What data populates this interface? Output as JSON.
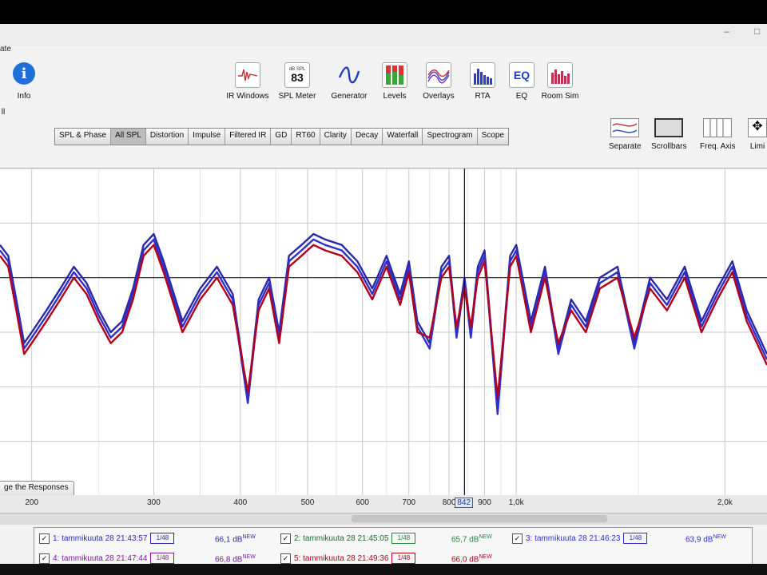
{
  "window": {
    "title_fragment": "ate"
  },
  "toolbar": {
    "info_label": "Info",
    "left_fragment": "ll",
    "spl_meter_icon_text": "dB SPL",
    "spl_meter_value": "83",
    "items": [
      {
        "label": "IR Windows",
        "icon": "ir-windows-icon"
      },
      {
        "label": "SPL Meter",
        "icon": "spl-meter-icon"
      },
      {
        "label": "Generator",
        "icon": "generator-icon"
      },
      {
        "label": "Levels",
        "icon": "levels-icon"
      },
      {
        "label": "Overlays",
        "icon": "overlays-icon"
      },
      {
        "label": "RTA",
        "icon": "rta-icon"
      },
      {
        "label": "EQ",
        "icon": "eq-icon"
      },
      {
        "label": "Room Sim",
        "icon": "room-sim-icon"
      }
    ]
  },
  "tabs": [
    "SPL & Phase",
    "All SPL",
    "Distortion",
    "Impulse",
    "Filtered IR",
    "GD",
    "RT60",
    "Clarity",
    "Decay",
    "Waterfall",
    "Spectrogram",
    "Scope"
  ],
  "active_tab": "All SPL",
  "right_tools": [
    {
      "label": "Separate",
      "icon": "separate-icon"
    },
    {
      "label": "Scrollbars",
      "icon": "scrollbars-icon"
    },
    {
      "label": "Freq. Axis",
      "icon": "freq-axis-icon"
    },
    {
      "label": "Limi",
      "icon": "limits-icon"
    }
  ],
  "x_ticks": [
    "200",
    "300",
    "400",
    "500",
    "600",
    "700",
    "800",
    "900",
    "1,0k",
    "2,0k"
  ],
  "cursor_readout": "842",
  "responses_button": "ge the Responses",
  "legend": [
    {
      "name": "1: tammikuuta 28 21:43:57",
      "level": "66,1 dB",
      "color": "#2a2aa8",
      "badge": "1/48"
    },
    {
      "name": "2: tammikuuta 28 21:45:05",
      "level": "65,7 dB",
      "color": "#1f8a3a",
      "badge": "1/48"
    },
    {
      "name": "3: tammikuuta 28 21:46:23",
      "level": "63,9 dB",
      "color": "#3030c8",
      "badge": "1/48"
    },
    {
      "name": "4: tammikuuta 28 21:47:44",
      "level": "66,8 dB",
      "color": "#7a1a9a",
      "badge": "1/48"
    },
    {
      "name": "5: tammikuuta 28 21:49:36",
      "level": "66,0 dB",
      "color": "#b3001b",
      "badge": "1/48"
    }
  ],
  "new_badge": "NEW",
  "chart_data": {
    "type": "line",
    "xlabel": "",
    "ylabel": "",
    "x_scale": "log",
    "xlim": [
      180,
      2300
    ],
    "grid": true,
    "cursor_x": 842,
    "series": [
      {
        "name": "1: tammikuuta 28 21:43:57",
        "color": "#2a2aa8",
        "x": [
          180,
          185,
          190,
          195,
          200,
          210,
          220,
          230,
          240,
          250,
          260,
          270,
          280,
          290,
          300,
          310,
          330,
          350,
          370,
          390,
          410,
          425,
          440,
          455,
          470,
          490,
          510,
          530,
          560,
          590,
          620,
          650,
          680,
          700,
          720,
          750,
          780,
          800,
          820,
          842,
          860,
          880,
          900,
          940,
          980,
          1000,
          1050,
          1100,
          1150,
          1200,
          1260,
          1320,
          1400,
          1480,
          1560,
          1650,
          1750,
          1850,
          1950,
          2050,
          2150,
          2300
        ],
        "y": [
          6,
          4,
          -4,
          -12,
          -10,
          -6,
          -2,
          2,
          -1,
          -6,
          -10,
          -8,
          -2,
          6,
          8,
          3,
          -8,
          -2,
          2,
          -3,
          -22,
          -4,
          0,
          -10,
          4,
          6,
          8,
          7,
          6,
          3,
          -2,
          4,
          -3,
          3,
          -8,
          -12,
          2,
          4,
          -10,
          0,
          -10,
          2,
          5,
          -24,
          4,
          6,
          -8,
          2,
          -13,
          -4,
          -8,
          0,
          2,
          -12,
          0,
          -4,
          2,
          -8,
          -2,
          3,
          -6,
          -14
        ]
      },
      {
        "name": "3: tammikuuta 28 21:46:23",
        "color": "#3030c8",
        "x": [
          180,
          185,
          190,
          195,
          200,
          210,
          220,
          230,
          240,
          250,
          260,
          270,
          280,
          290,
          300,
          310,
          330,
          350,
          370,
          390,
          410,
          425,
          440,
          455,
          470,
          490,
          510,
          530,
          560,
          590,
          620,
          650,
          680,
          700,
          720,
          750,
          780,
          800,
          820,
          842,
          860,
          880,
          900,
          940,
          980,
          1000,
          1050,
          1100,
          1150,
          1200,
          1260,
          1320,
          1400,
          1480,
          1560,
          1650,
          1750,
          1850,
          1950,
          2050,
          2150,
          2300
        ],
        "y": [
          5,
          3,
          -5,
          -13,
          -11,
          -7,
          -3,
          1,
          -2,
          -7,
          -11,
          -9,
          -3,
          5,
          7,
          2,
          -9,
          -3,
          1,
          -4,
          -23,
          -5,
          -1,
          -11,
          3,
          5,
          7,
          6,
          5,
          2,
          -3,
          3,
          -4,
          2,
          -9,
          -13,
          1,
          3,
          -11,
          -1,
          -11,
          1,
          4,
          -25,
          3,
          5,
          -9,
          1,
          -14,
          -5,
          -9,
          -1,
          1,
          -13,
          -1,
          -5,
          1,
          -9,
          -3,
          2,
          -7,
          -15
        ]
      },
      {
        "name": "5: tammikuuta 28 21:49:36",
        "color": "#b3001b",
        "x": [
          180,
          185,
          190,
          195,
          200,
          210,
          220,
          230,
          240,
          250,
          260,
          270,
          280,
          290,
          300,
          310,
          330,
          350,
          370,
          390,
          410,
          425,
          440,
          455,
          470,
          490,
          510,
          530,
          560,
          590,
          620,
          650,
          680,
          700,
          720,
          750,
          780,
          800,
          820,
          842,
          860,
          880,
          900,
          940,
          980,
          1000,
          1050,
          1100,
          1150,
          1200,
          1260,
          1320,
          1400,
          1480,
          1560,
          1650,
          1750,
          1850,
          1950,
          2050,
          2150,
          2300
        ],
        "y": [
          4,
          2,
          -6,
          -14,
          -12,
          -8,
          -4,
          0,
          -3,
          -8,
          -12,
          -10,
          -4,
          4,
          6,
          1,
          -10,
          -4,
          0,
          -5,
          -21,
          -6,
          -2,
          -12,
          2,
          4,
          6,
          5,
          4,
          1,
          -4,
          2,
          -5,
          1,
          -10,
          -11,
          0,
          2,
          -9,
          -2,
          -9,
          0,
          3,
          -22,
          2,
          4,
          -10,
          0,
          -12,
          -6,
          -10,
          -2,
          0,
          -11,
          -2,
          -6,
          0,
          -10,
          -4,
          1,
          -8,
          -16
        ]
      }
    ]
  }
}
